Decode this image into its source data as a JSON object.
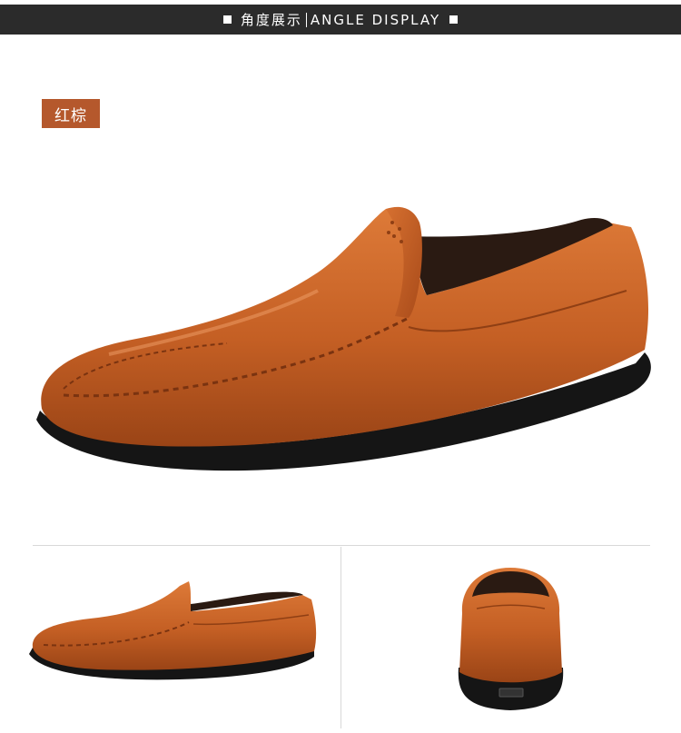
{
  "header": {
    "title_cn": "角度展示",
    "title_en": "ANGLE DISPLAY"
  },
  "color_label": "红棕",
  "colors": {
    "header_bg": "#2b2b2b",
    "tag_bg": "#b5582c",
    "leather": "#c45f24",
    "sole": "#151515"
  },
  "images": {
    "main": "shoe-three-quarter-view",
    "side": "shoe-side-view",
    "back": "shoe-back-view"
  }
}
